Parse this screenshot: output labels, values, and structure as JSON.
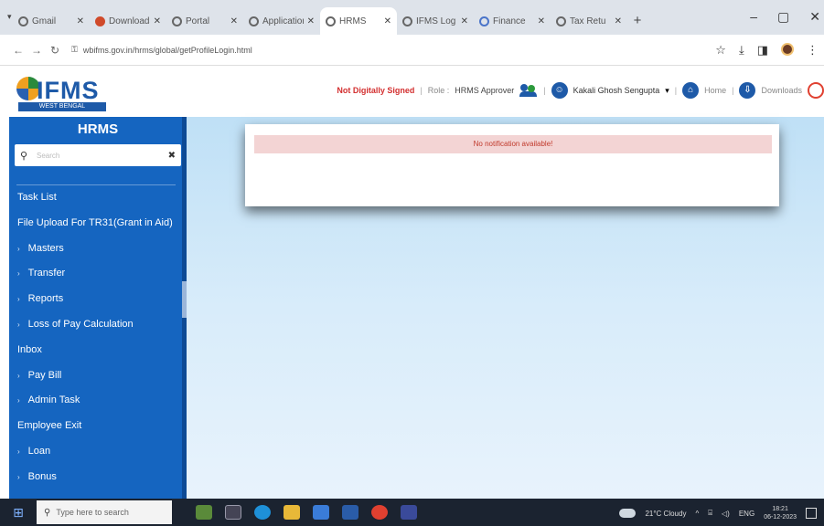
{
  "browser": {
    "tabs": [
      {
        "title": "Gmail",
        "favicon": "globe",
        "active": false
      },
      {
        "title": "Downloads",
        "favicon": "red",
        "active": false
      },
      {
        "title": "Portal",
        "favicon": "globe",
        "active": false
      },
      {
        "title": "Application",
        "favicon": "globe",
        "active": false
      },
      {
        "title": "HRMS",
        "favicon": "globe",
        "active": true
      },
      {
        "title": "IFMS Log",
        "favicon": "globe",
        "active": false
      },
      {
        "title": "Finance",
        "favicon": "g",
        "active": false
      },
      {
        "title": "Tax Retu",
        "favicon": "globe",
        "active": false
      }
    ],
    "url": "wbifms.gov.in/hrms/global/getProfileLogin.html",
    "window_controls": [
      "–",
      "▢",
      "✕"
    ]
  },
  "header": {
    "logo_text": "IFMS",
    "logo_subtext": "WEST BENGAL",
    "signature_status": "Not Digitally Signed",
    "role_label": "Role :",
    "role_value": "HRMS Approver",
    "user_name": "Kakali Ghosh Sengupta",
    "home_label": "Home",
    "downloads_label": "Downloads"
  },
  "sidebar": {
    "title": "HRMS",
    "search_placeholder": "Search",
    "items": [
      {
        "label": "Task List",
        "sub": false
      },
      {
        "label": "File Upload For TR31(Grant in Aid)",
        "sub": false
      },
      {
        "label": "Masters",
        "sub": true
      },
      {
        "label": "Transfer",
        "sub": true
      },
      {
        "label": "Reports",
        "sub": true
      },
      {
        "label": "Loss of Pay Calculation",
        "sub": true
      },
      {
        "label": "Inbox",
        "sub": false
      },
      {
        "label": "Pay Bill",
        "sub": true
      },
      {
        "label": "Admin Task",
        "sub": true
      },
      {
        "label": "Employee Exit",
        "sub": false
      },
      {
        "label": "Loan",
        "sub": true
      },
      {
        "label": "Bonus",
        "sub": true
      }
    ]
  },
  "main": {
    "notification_message": "No notification available!"
  },
  "taskbar": {
    "search_placeholder": "Type here to search",
    "weather": "21°C Cloudy",
    "lang": "ENG",
    "time": "18:21",
    "date": "06-12-2023"
  }
}
